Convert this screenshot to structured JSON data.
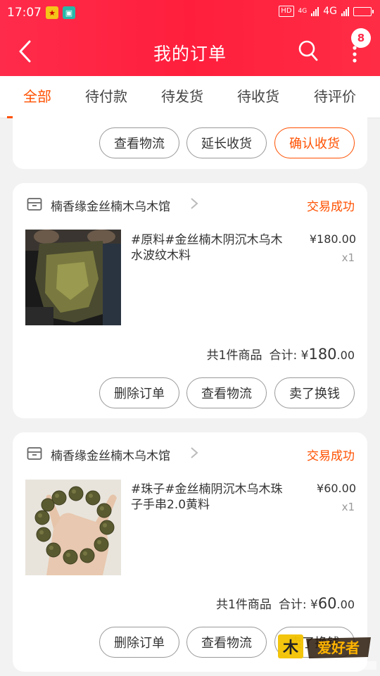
{
  "status_bar": {
    "time": "17:07",
    "hd": "HD",
    "net_small": "4G",
    "net": "4G"
  },
  "header": {
    "title": "我的订单",
    "more_badge_count": "8"
  },
  "tabs": [
    {
      "label": "全部",
      "active": true
    },
    {
      "label": "待付款",
      "active": false
    },
    {
      "label": "待发货",
      "active": false
    },
    {
      "label": "待收货",
      "active": false
    },
    {
      "label": "待评价",
      "active": false
    }
  ],
  "card0": {
    "buttons": [
      "查看物流",
      "延长收货",
      "确认收货"
    ]
  },
  "orders": [
    {
      "shop_name": "楠香缘金丝楠木乌木馆",
      "status": "交易成功",
      "title": "#原料#金丝楠木阴沉木乌木水波纹木料",
      "price": "¥180.00",
      "qty": "x1",
      "count_label": "共1件商品",
      "total_label": "合计:",
      "total_currency": "¥",
      "total_main": "180",
      "total_cents": ".00",
      "buttons": [
        "删除订单",
        "查看物流",
        "卖了换钱"
      ]
    },
    {
      "shop_name": "楠香缘金丝楠木乌木馆",
      "status": "交易成功",
      "title": "#珠子#金丝楠阴沉木乌木珠子手串2.0黄料",
      "price": "¥60.00",
      "qty": "x1",
      "count_label": "共1件商品",
      "total_label": "合计:",
      "total_currency": "¥",
      "total_main": "60",
      "total_cents": ".00",
      "buttons": [
        "删除订单",
        "查看物流",
        "卖了换钱"
      ]
    }
  ],
  "colors": {
    "header_red": "#ff2b4a",
    "accent_orange": "#ff5000",
    "background": "#f2f2f2"
  },
  "icons": [
    "back-arrow-icon",
    "search-icon",
    "more-vertical-icon",
    "shop-icon",
    "chevron-right-icon"
  ]
}
